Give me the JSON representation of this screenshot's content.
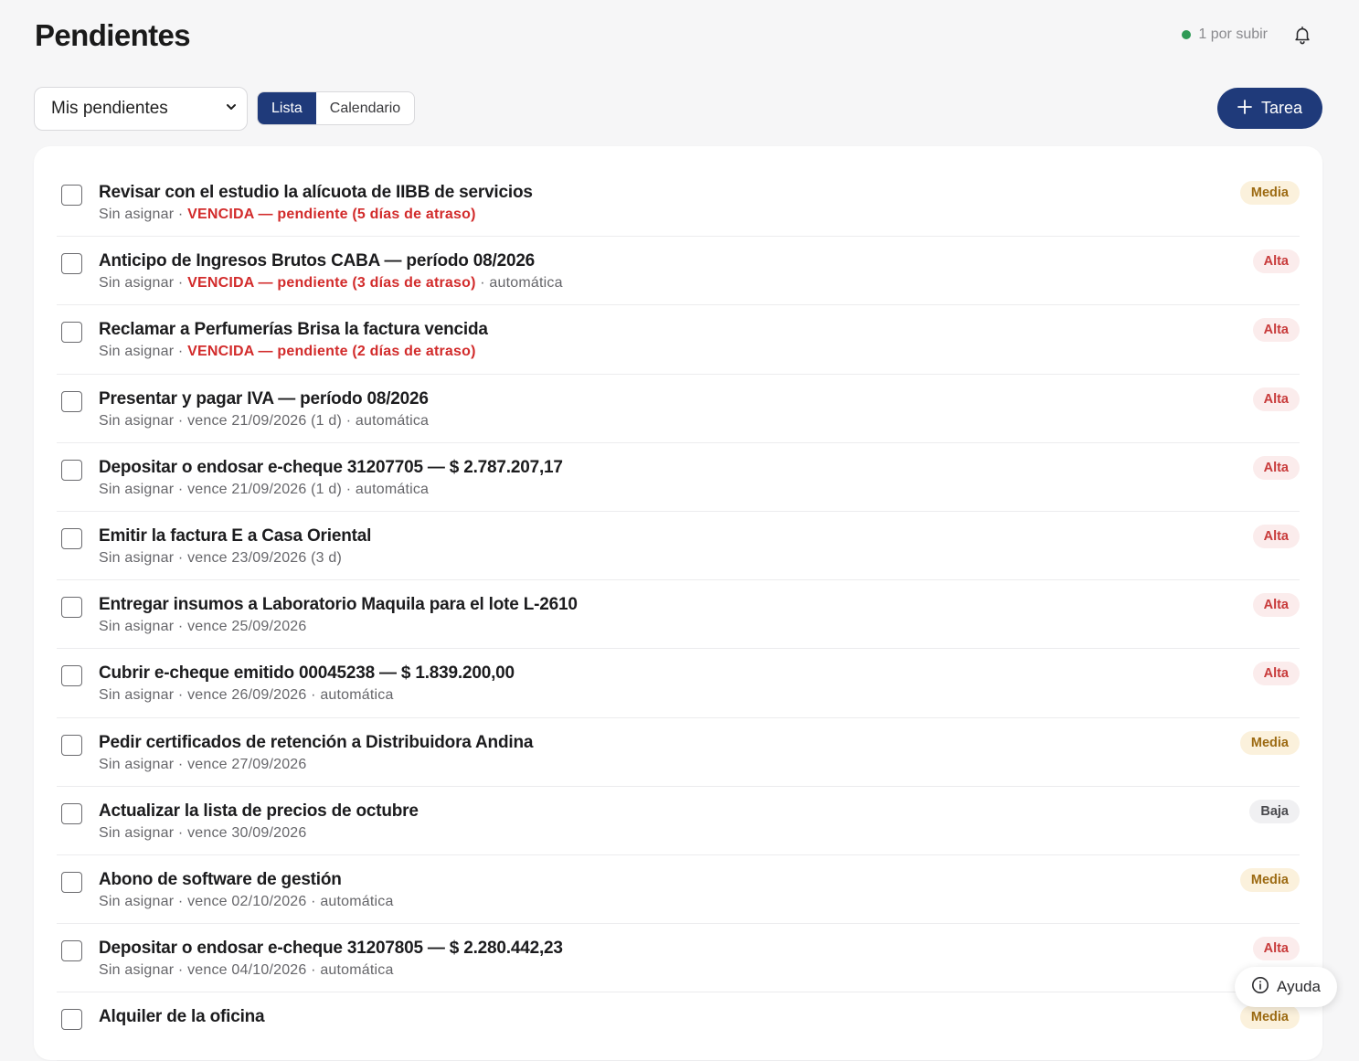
{
  "header": {
    "title": "Pendientes",
    "status_text": "1 por subir",
    "status_color": "#2e9a55"
  },
  "toolbar": {
    "filter_selected": "Mis pendientes",
    "view_tabs": [
      {
        "label": "Lista",
        "active": true
      },
      {
        "label": "Calendario",
        "active": false
      }
    ],
    "add_label": "Tarea"
  },
  "tasks": [
    {
      "title": "Revisar con el estudio la alícuota de IIBB de servicios",
      "assignee": "Sin asignar",
      "due": "",
      "overdue": "VENCIDA — pendiente (5 días de atraso)",
      "auto": "",
      "priority": "Media",
      "level": "media"
    },
    {
      "title": "Anticipo de Ingresos Brutos CABA — período 08/2026",
      "assignee": "Sin asignar",
      "due": "",
      "overdue": "VENCIDA — pendiente (3 días de atraso)",
      "auto": "automática",
      "priority": "Alta",
      "level": "alta"
    },
    {
      "title": "Reclamar a Perfumerías Brisa la factura vencida",
      "assignee": "Sin asignar",
      "due": "",
      "overdue": "VENCIDA — pendiente (2 días de atraso)",
      "auto": "",
      "priority": "Alta",
      "level": "alta"
    },
    {
      "title": "Presentar y pagar IVA — período 08/2026",
      "assignee": "Sin asignar",
      "due": "vence 21/09/2026 (1 d)",
      "overdue": "",
      "auto": "automática",
      "priority": "Alta",
      "level": "alta"
    },
    {
      "title": "Depositar o endosar e-cheque 31207705 — $ 2.787.207,17",
      "assignee": "Sin asignar",
      "due": "vence 21/09/2026 (1 d)",
      "overdue": "",
      "auto": "automática",
      "priority": "Alta",
      "level": "alta"
    },
    {
      "title": "Emitir la factura E a Casa Oriental",
      "assignee": "Sin asignar",
      "due": "vence 23/09/2026 (3 d)",
      "overdue": "",
      "auto": "",
      "priority": "Alta",
      "level": "alta"
    },
    {
      "title": "Entregar insumos a Laboratorio Maquila para el lote L-2610",
      "assignee": "Sin asignar",
      "due": "vence 25/09/2026",
      "overdue": "",
      "auto": "",
      "priority": "Alta",
      "level": "alta"
    },
    {
      "title": "Cubrir e-cheque emitido 00045238 — $ 1.839.200,00",
      "assignee": "Sin asignar",
      "due": "vence 26/09/2026",
      "overdue": "",
      "auto": "automática",
      "priority": "Alta",
      "level": "alta"
    },
    {
      "title": "Pedir certificados de retención a Distribuidora Andina",
      "assignee": "Sin asignar",
      "due": "vence 27/09/2026",
      "overdue": "",
      "auto": "",
      "priority": "Media",
      "level": "media"
    },
    {
      "title": "Actualizar la lista de precios de octubre",
      "assignee": "Sin asignar",
      "due": "vence 30/09/2026",
      "overdue": "",
      "auto": "",
      "priority": "Baja",
      "level": "baja"
    },
    {
      "title": "Abono de software de gestión",
      "assignee": "Sin asignar",
      "due": "vence 02/10/2026",
      "overdue": "",
      "auto": "automática",
      "priority": "Media",
      "level": "media"
    },
    {
      "title": "Depositar o endosar e-cheque 31207805 — $ 2.280.442,23",
      "assignee": "Sin asignar",
      "due": "vence 04/10/2026",
      "overdue": "",
      "auto": "automática",
      "priority": "Alta",
      "level": "alta"
    },
    {
      "title": "Alquiler de la oficina",
      "assignee": "",
      "due": "",
      "overdue": "",
      "auto": "",
      "priority": "Media",
      "level": "media"
    }
  ],
  "help": {
    "label": "Ayuda"
  },
  "colors": {
    "primary": "#1f3a7a",
    "overdue": "#d22b2b"
  }
}
